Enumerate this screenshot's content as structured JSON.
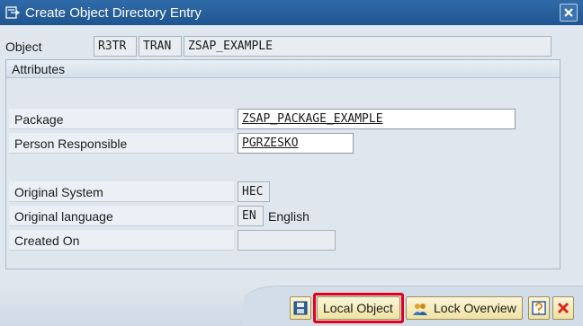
{
  "window": {
    "title": "Create Object Directory Entry"
  },
  "object": {
    "label": "Object",
    "pgmid": "R3TR",
    "type": "TRAN",
    "name": "ZSAP_EXAMPLE"
  },
  "attributes": {
    "header": "Attributes",
    "package_label": "Package",
    "package_value": "ZSAP_PACKAGE_EXAMPLE",
    "person_label": "Person Responsible",
    "person_value": "PGRZESKO",
    "system_label": "Original System",
    "system_value": "HEC",
    "language_label": "Original language",
    "language_code": "EN",
    "language_name": "English",
    "created_label": "Created On",
    "created_value": ""
  },
  "footer": {
    "local_object_label": "Local Object",
    "lock_overview_label": "Lock Overview"
  },
  "icons": [
    "create-entry-icon",
    "close-icon",
    "save-icon",
    "lock-overview-icon",
    "help-icon",
    "cancel-icon"
  ]
}
